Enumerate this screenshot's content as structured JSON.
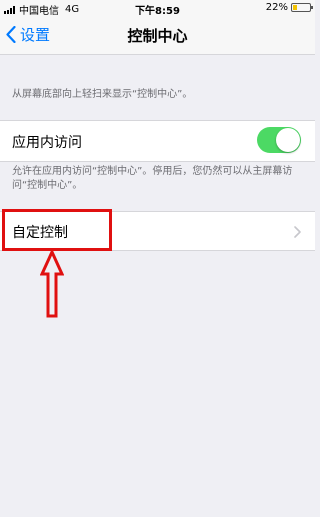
{
  "status_bar": {
    "carrier": "中国电信",
    "network": "4G",
    "time": "下午8:59",
    "battery_percent": "22%",
    "battery_level": 0.22
  },
  "nav": {
    "back_label": "设置",
    "title": "控制中心"
  },
  "captions": {
    "top": "从屏幕底部向上轻扫来显示“控制中心”。",
    "app_access_footer": "允许在应用内访问“控制中心”。停用后，您仍然可以从主屏幕访问“控制中心”。"
  },
  "settings": {
    "app_access_label": "应用内访问",
    "app_access_enabled": true,
    "customize_label": "自定控制"
  },
  "colors": {
    "accent": "#007aff",
    "toggle_on": "#4cd964",
    "highlight": "#e01010"
  }
}
